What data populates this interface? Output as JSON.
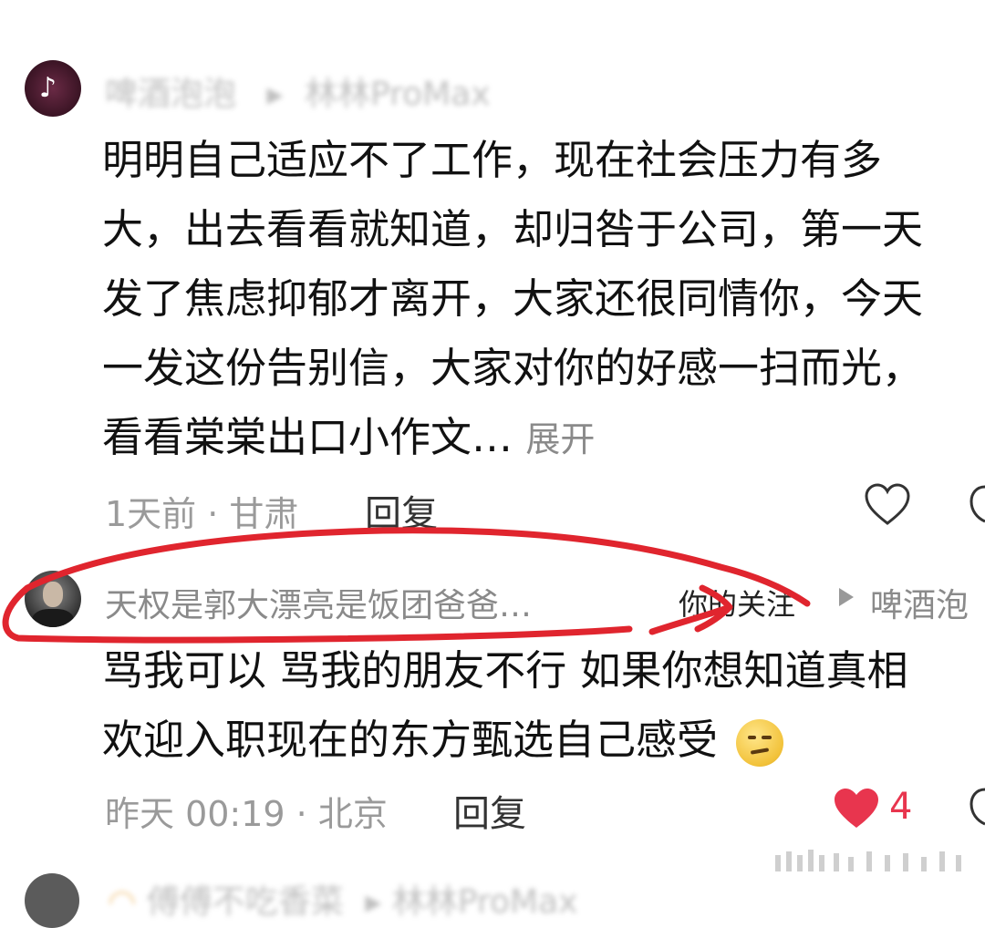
{
  "comments": [
    {
      "username": "啤酒泡泡",
      "device": "林林ProMax",
      "lines": [
        "明明自己适应不了工作，现在社会压力有多",
        "大，出去看看就知道，却归咎于公司，第一天",
        "发了焦虑抑郁才离开，大家还很同情你，今天",
        "一发这份告别信，大家对你的好感一扫而光，",
        "看看棠棠出口小作文…"
      ],
      "expand_label": "展开",
      "meta": "1天前 · 甘肃",
      "reply_label": "回复"
    },
    {
      "username": "天权是郭大漂亮是饭团爸爸…",
      "badge": "你的关注",
      "reply_to": "啤酒泡",
      "lines": [
        "骂我可以 骂我的朋友不行 如果你想知道真相",
        "欢迎入职现在的东方甄选自己感受"
      ],
      "meta": "昨天 00:19 · 北京",
      "reply_label": "回复",
      "like_count": "4"
    },
    {
      "username": "傅傅不吃香菜",
      "reply_to": "林林ProMax"
    }
  ],
  "colors": {
    "annotation_red": "#e0252e",
    "liked_heart": "#e8354e"
  }
}
